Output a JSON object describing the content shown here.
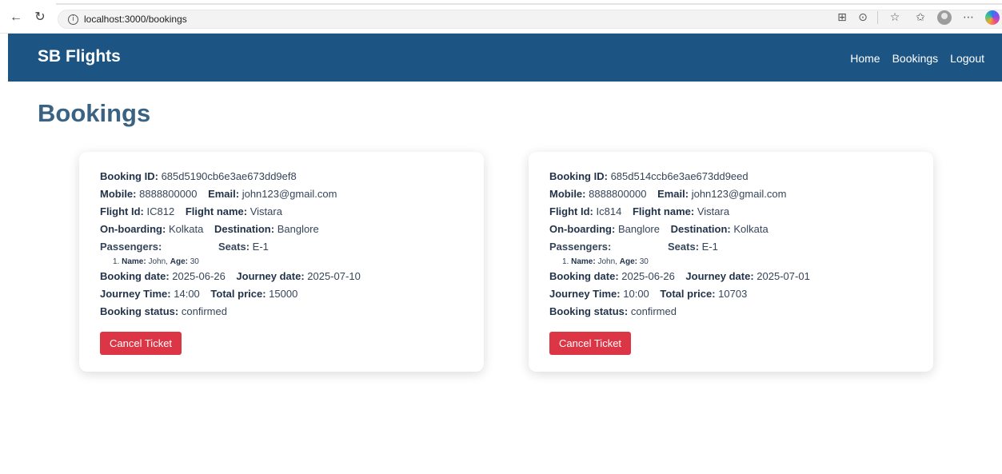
{
  "browser": {
    "url": "localhost:3000/bookings"
  },
  "navbar": {
    "brand": "SB Flights",
    "links": [
      "Home",
      "Bookings",
      "Logout"
    ]
  },
  "page": {
    "title": "Bookings"
  },
  "labels": {
    "booking_id": "Booking ID:",
    "mobile": "Mobile:",
    "email": "Email:",
    "flight_id": "Flight Id:",
    "flight_name": "Flight name:",
    "on_boarding": "On-boarding:",
    "destination": "Destination:",
    "passengers": "Passengers:",
    "seats": "Seats:",
    "name": "Name:",
    "age": "Age:",
    "booking_date": "Booking date:",
    "journey_date": "Journey date:",
    "journey_time": "Journey Time:",
    "total_price": "Total price:",
    "booking_status": "Booking status:",
    "cancel_button": "Cancel Ticket"
  },
  "bookings": [
    {
      "booking_id": "685d5190cb6e3ae673dd9ef8",
      "mobile": "8888800000",
      "email": "john123@gmail.com",
      "flight_id": "IC812",
      "flight_name": "Vistara",
      "on_boarding": "Kolkata",
      "destination": "Banglore",
      "seats": "E-1",
      "passenger_index": "1.",
      "passenger_name": "John,",
      "passenger_age": "30",
      "booking_date": "2025-06-26",
      "journey_date": "2025-07-10",
      "journey_time": "14:00",
      "total_price": "15000",
      "booking_status": "confirmed"
    },
    {
      "booking_id": "685d514ccb6e3ae673dd9eed",
      "mobile": "8888800000",
      "email": "john123@gmail.com",
      "flight_id": "Ic814",
      "flight_name": "Vistara",
      "on_boarding": "Banglore",
      "destination": "Kolkata",
      "seats": "E-1",
      "passenger_index": "1.",
      "passenger_name": "John,",
      "passenger_age": "30",
      "booking_date": "2025-06-26",
      "journey_date": "2025-07-01",
      "journey_time": "10:00",
      "total_price": "10703",
      "booking_status": "confirmed"
    }
  ]
}
